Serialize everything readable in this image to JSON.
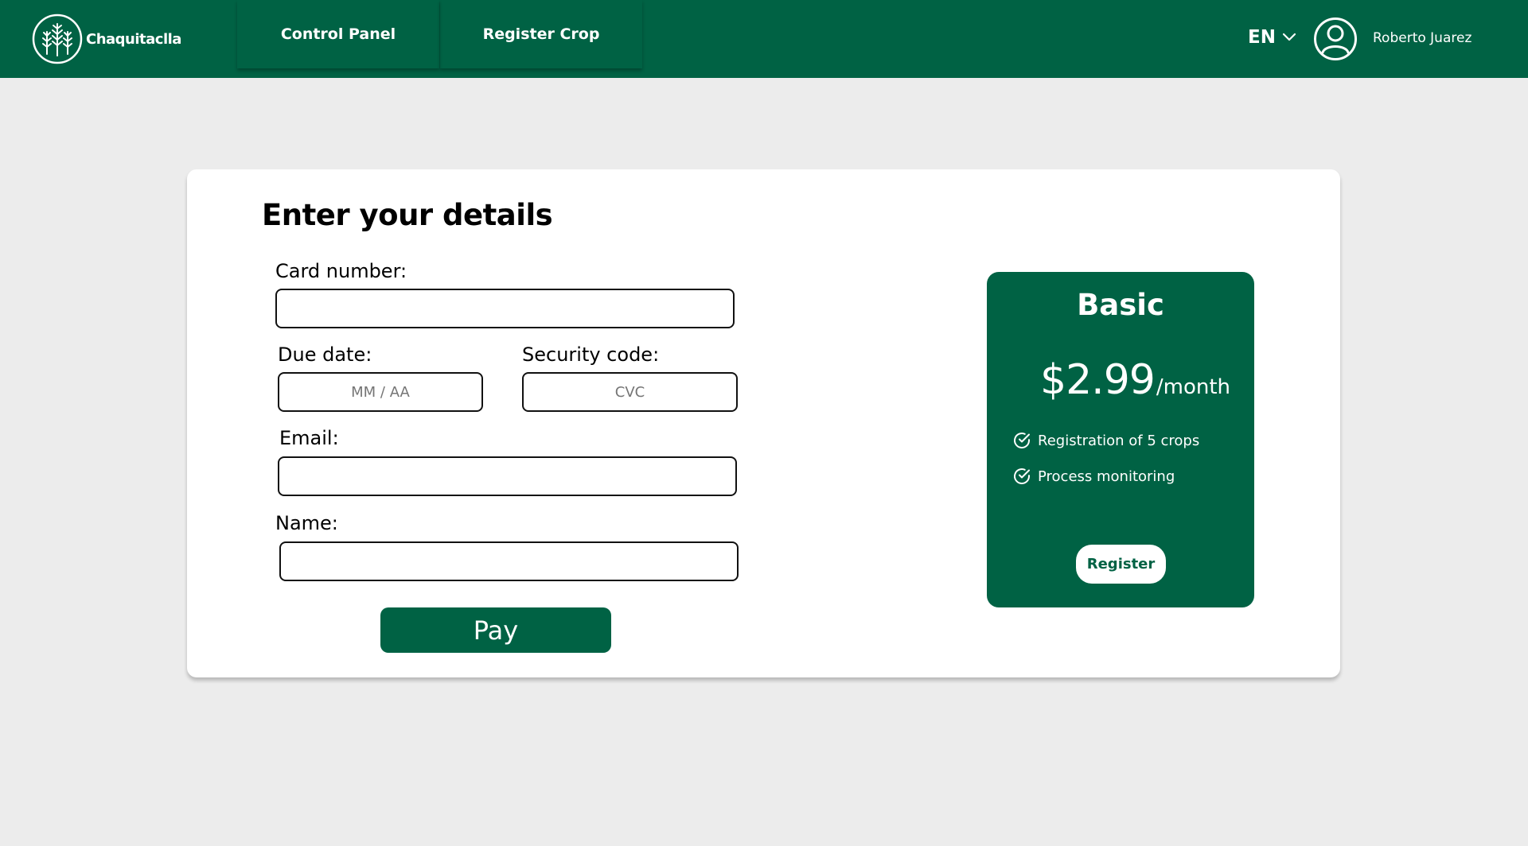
{
  "colors": {
    "brand": "#006244",
    "background": "#ececec",
    "card": "#ffffff"
  },
  "header": {
    "logo_text": "Chaquitaclla",
    "nav": [
      {
        "label": "Control Panel"
      },
      {
        "label": "Register Crop"
      }
    ],
    "language": "EN",
    "user_name": "Roberto Juarez",
    "icons": [
      "wheat-logo-icon",
      "chevron-down-icon",
      "user-avatar-icon"
    ]
  },
  "form": {
    "title": "Enter your details",
    "card_number": {
      "label": "Card number:",
      "value": "",
      "placeholder": ""
    },
    "due_date": {
      "label": "Due date:",
      "value": "",
      "placeholder": "MM / AA"
    },
    "security_code": {
      "label": "Security code:",
      "value": "",
      "placeholder": "CVC"
    },
    "email": {
      "label": "Email:",
      "value": "",
      "placeholder": ""
    },
    "name": {
      "label": "Name:",
      "value": "",
      "placeholder": ""
    },
    "pay_label": "Pay"
  },
  "plan": {
    "name": "Basic",
    "price": "$2.99",
    "period": "/month",
    "features": [
      {
        "label": "Registration of 5 crops",
        "icon": "check-circle-icon"
      },
      {
        "label": "Process monitoring",
        "icon": "check-circle-icon"
      }
    ],
    "register_label": "Register"
  }
}
